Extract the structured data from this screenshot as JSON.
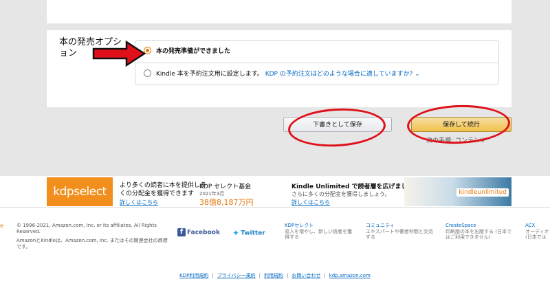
{
  "section": {
    "label": "本の発売オプション"
  },
  "options": [
    {
      "text": "本の発売準備ができました",
      "selected": true
    },
    {
      "text": "Kindle 本を予約注文用に設定します。",
      "link": "KDP の予約注文はどのような場合に適していますか?",
      "selected": false
    }
  ],
  "buttons": {
    "draft": "下書きとして保存",
    "save_continue": "保存して続行",
    "next_step": "次の手順: コンテンツ"
  },
  "promo": {
    "logo": "kdpselect",
    "text": "より多くの読者に本を提供し多くの分配金を獲得できます",
    "link": "詳しくはこちら",
    "fund_title": "KDP セレクト基金",
    "fund_date": "2021年3月",
    "fund_amount": "38億8,187万円",
    "ku_title": "Kindle Unlimited で読者層を広げましょう。",
    "ku_sub": "さらに多くの分配金を獲得しましょう。",
    "ku_link": "詳しくはこちら",
    "ku_logo": "kindleunlimited"
  },
  "footer": {
    "edge": "e",
    "copyright": "© 1996-2021, Amazon.com, Inc. or its affiliates. All Rights Reserved.",
    "trademark": "AmazonとKindleは、Amazon.com, Inc. またはその関連会社の商標です。",
    "facebook": "Facebook",
    "twitter": "Twitter",
    "col1_title": "KDPセレクト",
    "col1_text": "収入を増やし、新しい読者を獲得する",
    "col2_title": "コミュニティ",
    "col2_text": "エキスパートや著者仲間と交流する",
    "col3_title": "CreateSpace",
    "col3_text": "印刷版の本を出版する (日本ではご利用できません)",
    "col4_title": "ACX",
    "col4_text": "オーディオ (日本では",
    "links": [
      "KDP利用規約",
      "プライバシー規約",
      "利用規約",
      "お問い合わせ",
      "kdp.amazon.com"
    ]
  },
  "colors": {
    "accent_orange": "#e77600",
    "link_blue": "#0066c0",
    "annotation_red": "#e0101a",
    "save_button": "#f0c14b"
  }
}
